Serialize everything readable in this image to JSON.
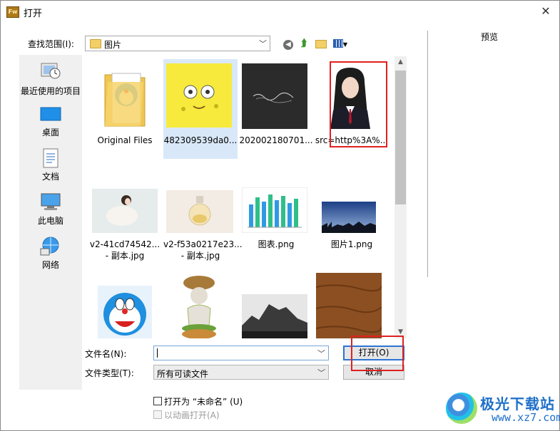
{
  "window": {
    "title": "打开",
    "app_icon_text": "Fw",
    "close_glyph": "✕"
  },
  "toolbar": {
    "lookin_label": "查找范围(I):",
    "lookin_value": "图片",
    "icons": [
      "back-icon",
      "up-folder-icon",
      "new-folder-icon",
      "view-menu-icon"
    ]
  },
  "preview": {
    "label": "预览"
  },
  "places": [
    {
      "label": "最近使用的项目",
      "icon": "recent-items-icon"
    },
    {
      "label": "桌面",
      "icon": "desktop-icon"
    },
    {
      "label": "文档",
      "icon": "documents-icon"
    },
    {
      "label": "此电脑",
      "icon": "this-pc-icon"
    },
    {
      "label": "网络",
      "icon": "network-icon"
    }
  ],
  "files": [
    {
      "name": "Original Files",
      "kind": "folder"
    },
    {
      "name": "482309539da0...",
      "kind": "image",
      "selected": true
    },
    {
      "name": "202002180701...",
      "kind": "image"
    },
    {
      "name": "src=http%3A%...",
      "kind": "image",
      "highlighted": true
    },
    {
      "name": "v2-41cd74542...",
      "name2": "- 副本.jpg",
      "kind": "image"
    },
    {
      "name": "v2-f53a0217e23...",
      "name2": "- 副本.jpg",
      "kind": "image"
    },
    {
      "name": "图表.png",
      "kind": "image"
    },
    {
      "name": "图片1.png",
      "kind": "image"
    },
    {
      "name": "",
      "kind": "image"
    },
    {
      "name": "",
      "kind": "image"
    },
    {
      "name": "",
      "kind": "image"
    },
    {
      "name": "",
      "kind": "image"
    }
  ],
  "form": {
    "filename_label": "文件名(N):",
    "filename_value": "",
    "filetype_label": "文件类型(T):",
    "filetype_value": "所有可读文件",
    "open_button": "打开(O)",
    "cancel_button": "取消",
    "open_untitled_label": "打开为 “未命名” (U)",
    "open_as_animation_label": "以动画打开(A)"
  },
  "watermark": {
    "title": "极光下载站",
    "url": "www.xz7.com"
  },
  "colors": {
    "highlight_red": "#e02020",
    "selection_blue": "#d9e8f8",
    "accent_blue": "#2c74d2"
  }
}
